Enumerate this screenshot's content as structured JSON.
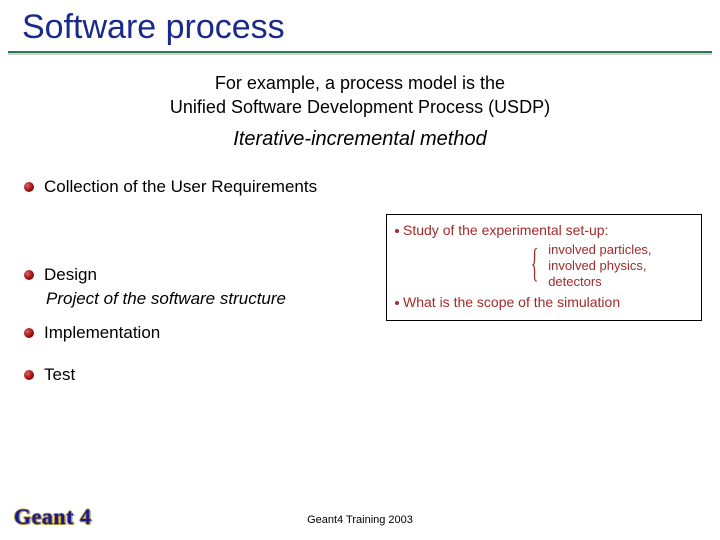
{
  "title": "Software process",
  "intro_line1": "For example, a process model is the",
  "intro_line2": "Unified Software Development Process (USDP)",
  "subtitle": "Iterative-incremental method",
  "bullets": {
    "b1": "Collection of the User Requirements",
    "b2": "Design",
    "b2_sub": "Project of the software structure",
    "b3": "Implementation",
    "b4": "Test"
  },
  "box": {
    "line1": "Study of the experimental set-up:",
    "sub1": "involved particles,",
    "sub2": "involved  physics,",
    "sub3": "detectors",
    "line2": "What is the scope of the simulation"
  },
  "footer": {
    "logo": "Geant 4",
    "center": "Geant4 Training 2003"
  }
}
